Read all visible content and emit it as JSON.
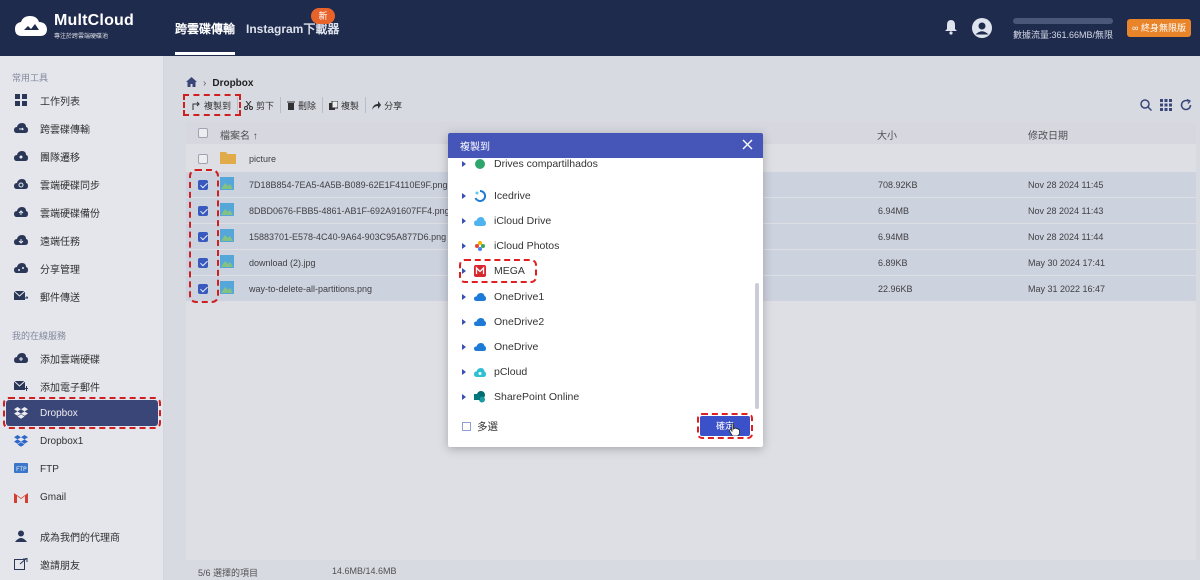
{
  "app": {
    "name": "MultCloud",
    "tagline": "專注於跨雲端硬碟池",
    "tabs": [
      {
        "label": "跨雲碟傳輸",
        "active": true
      },
      {
        "label": "Instagram下載器",
        "active": false
      }
    ],
    "new_badge": "新",
    "traffic": "數據流量:361.66MB/無限",
    "upgrade_label": "終身無限版",
    "accent": "#1f2b4d",
    "highlight": "#e02020"
  },
  "sidebar": {
    "section1": "常用工具",
    "tools": [
      {
        "label": "工作列表",
        "icon": "grid-icon"
      },
      {
        "label": "跨雲碟傳輸",
        "icon": "cloud-transfer-icon"
      },
      {
        "label": "團隊遷移",
        "icon": "team-migrate-icon"
      },
      {
        "label": "雲端硬碟同步",
        "icon": "cloud-sync-icon"
      },
      {
        "label": "雲端硬碟備份",
        "icon": "cloud-backup-icon"
      },
      {
        "label": "遠端任務",
        "icon": "remote-upload-icon"
      },
      {
        "label": "分享管理",
        "icon": "share-icon"
      },
      {
        "label": "郵件傳送",
        "icon": "email-migrate-icon"
      }
    ],
    "section2": "我的在線服務",
    "services": [
      {
        "label": "添加雲端硬碟",
        "icon": "add-cloud-icon"
      },
      {
        "label": "添加電子郵件",
        "icon": "add-email-icon"
      },
      {
        "label": "Dropbox",
        "icon": "dropbox-icon",
        "active": true
      },
      {
        "label": "Dropbox1",
        "icon": "dropbox-icon"
      },
      {
        "label": "FTP",
        "icon": "ftp-icon"
      },
      {
        "label": "Gmail",
        "icon": "gmail-icon"
      }
    ],
    "bottom": [
      {
        "label": "成為我們的代理商",
        "icon": "agent-icon"
      },
      {
        "label": "邀請朋友",
        "icon": "invite-icon"
      }
    ]
  },
  "breadcrumb": {
    "current": "Dropbox"
  },
  "toolbar": {
    "copy_to": "複製到",
    "cut": "剪下",
    "delete": "刪除",
    "copy": "複製",
    "share": "分享"
  },
  "table": {
    "col_name": "檔案名 ↑",
    "col_size": "大小",
    "col_modified": "修改日期",
    "rows": [
      {
        "name": "picture",
        "size": "",
        "date": "",
        "type": "folder",
        "checked": false
      },
      {
        "name": "7D18B854-7EA5-4A5B-B089-62E1F4110E9F.png",
        "size": "708.92KB",
        "date": "Nov 28 2024 11:45",
        "type": "image",
        "checked": true
      },
      {
        "name": "8DBD0676-FBB5-4861-AB1F-692A91607FF4.png",
        "size": "6.94MB",
        "date": "Nov 28 2024 11:43",
        "type": "image",
        "checked": true
      },
      {
        "name": "15883701-E578-4C40-9A64-903C95A877D6.png",
        "size": "6.94MB",
        "date": "Nov 28 2024 11:44",
        "type": "image",
        "checked": true
      },
      {
        "name": "download (2).jpg",
        "size": "6.89KB",
        "date": "May 30 2024 17:41",
        "type": "image",
        "checked": true
      },
      {
        "name": "way-to-delete-all-partitions.png",
        "size": "22.96KB",
        "date": "May 31 2022 16:47",
        "type": "image",
        "checked": true
      }
    ]
  },
  "footer": {
    "selected": "5/6 選擇的項目",
    "size": "14.6MB/14.6MB"
  },
  "dialog": {
    "title": "複製到",
    "items": [
      {
        "label": "Drives compartilhados",
        "icon": "gdrive-shared-icon"
      },
      {
        "label": "Icedrive",
        "icon": "icedrive-icon"
      },
      {
        "label": "iCloud Drive",
        "icon": "icloud-drive-icon"
      },
      {
        "label": "iCloud Photos",
        "icon": "icloud-photos-icon"
      },
      {
        "label": "MEGA",
        "icon": "mega-icon",
        "highlighted": true
      },
      {
        "label": "OneDrive1",
        "icon": "onedrive-icon"
      },
      {
        "label": "OneDrive2",
        "icon": "onedrive-icon"
      },
      {
        "label": "OneDrive",
        "icon": "onedrive-icon"
      },
      {
        "label": "pCloud",
        "icon": "pcloud-icon"
      },
      {
        "label": "SharePoint Online",
        "icon": "sharepoint-icon"
      }
    ],
    "multi_select": "多選",
    "confirm": "確定"
  }
}
